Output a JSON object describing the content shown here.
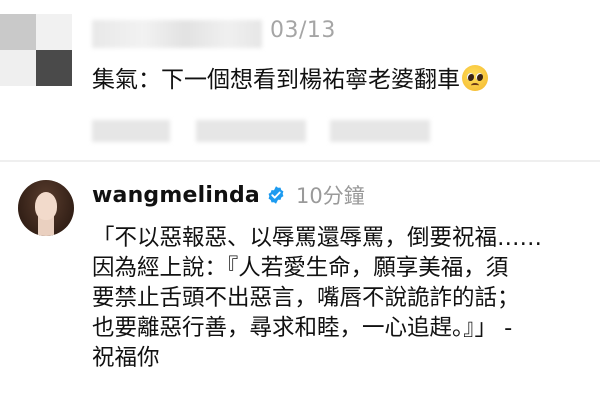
{
  "comment1": {
    "date": "03/13",
    "text": "集氣：下一個想看到楊祐寧老婆翻車",
    "emoji": "pleading-face"
  },
  "comment2": {
    "username": "wangmelinda",
    "verified": true,
    "time": "10分鐘",
    "lines": [
      "「不以惡報惡、以辱罵還辱罵，倒要祝福……",
      "因為經上說：『人若愛生命，願享美福，須",
      "要禁止舌頭不出惡言，嘴唇不說詭詐的話；",
      "也要離惡行善，尋求和睦，一心追趕。』」 -",
      "祝福你"
    ]
  },
  "colors": {
    "verified_badge": "#1d9bf0",
    "meta_text": "#a5a5a5",
    "body_text": "#111111"
  }
}
